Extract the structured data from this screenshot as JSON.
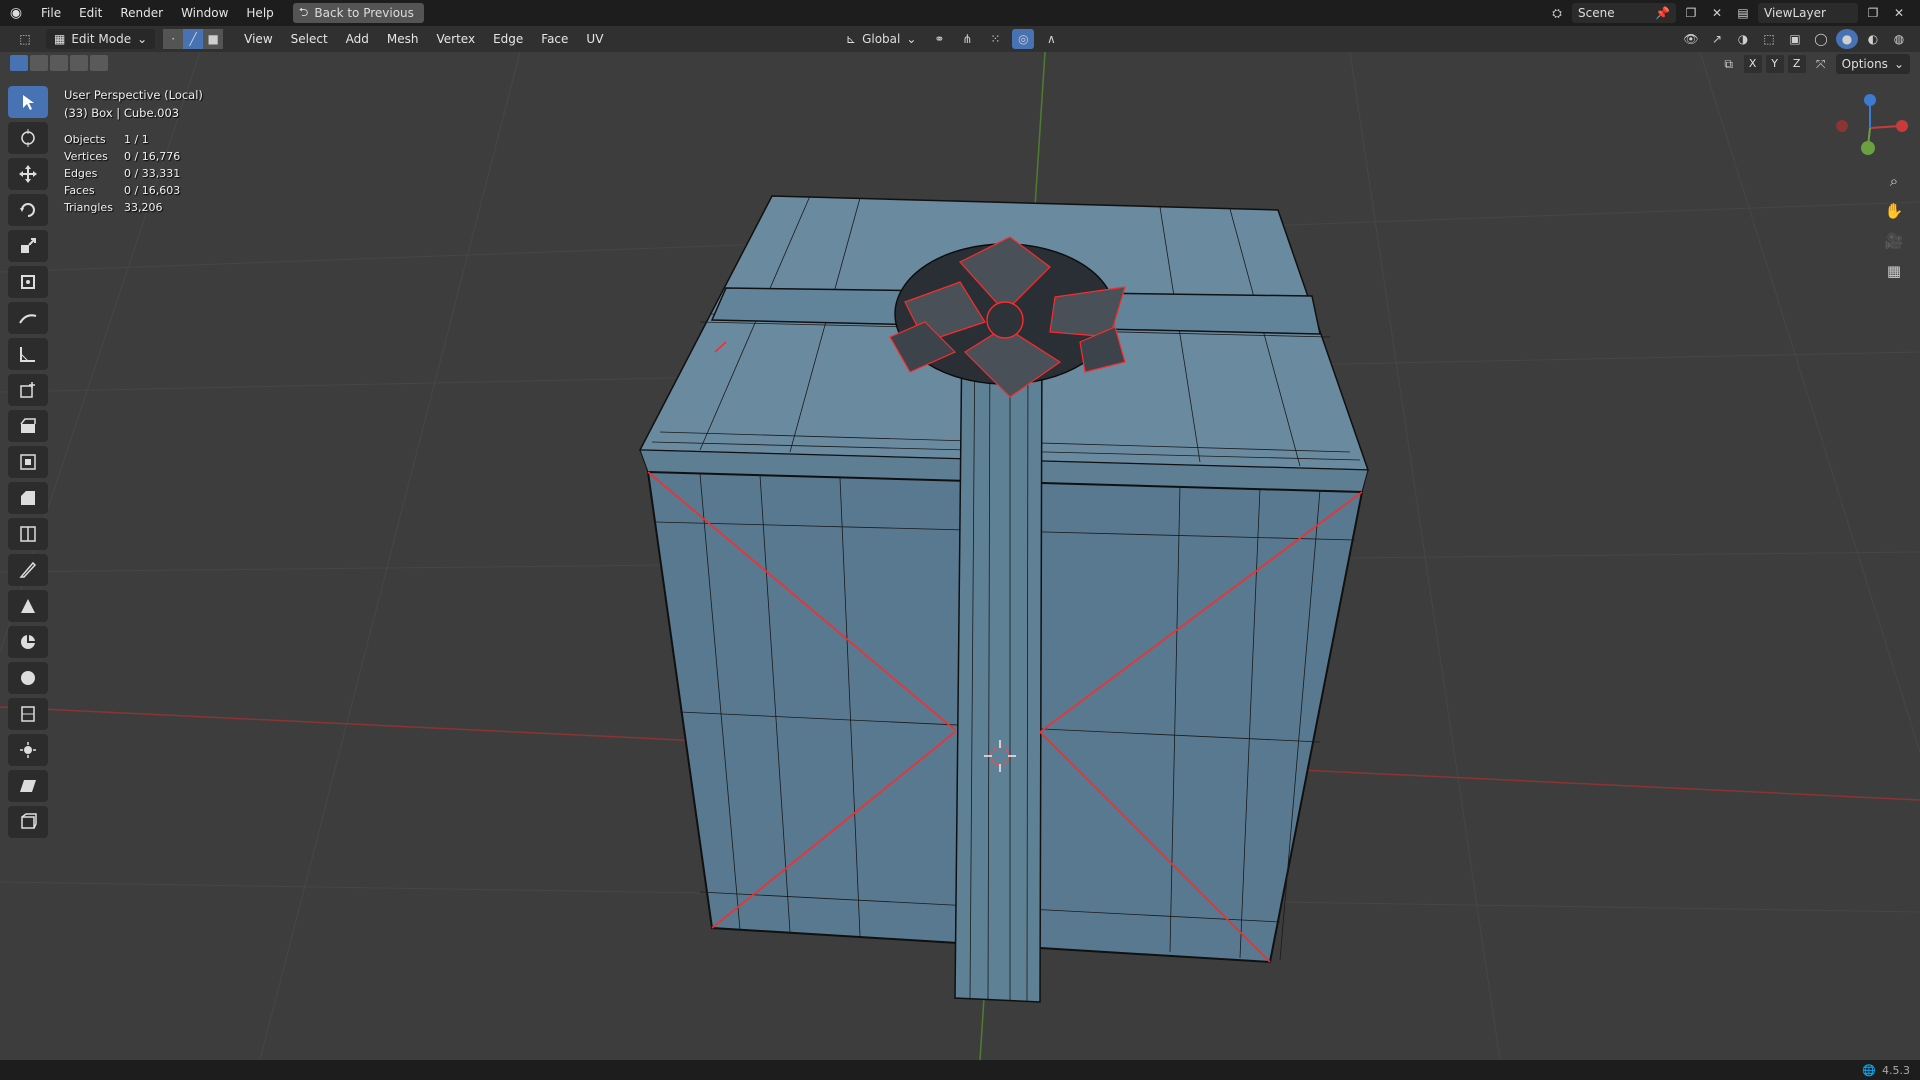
{
  "topbar": {
    "menus": [
      "File",
      "Edit",
      "Render",
      "Window",
      "Help"
    ],
    "back_label": "Back to Previous",
    "scene": "Scene",
    "viewlayer": "ViewLayer"
  },
  "header": {
    "mode": "Edit Mode",
    "menus": [
      "View",
      "Select",
      "Add",
      "Mesh",
      "Vertex",
      "Edge",
      "Face",
      "UV"
    ],
    "orientation": "Global",
    "options_label": "Options",
    "axes": [
      "X",
      "Y",
      "Z"
    ]
  },
  "viewport": {
    "view_name": "User Perspective (Local)",
    "object_info": "(33) Box | Cube.003",
    "stats": [
      {
        "label": "Objects",
        "value": "1 / 1"
      },
      {
        "label": "Vertices",
        "value": "0 / 16,776"
      },
      {
        "label": "Edges",
        "value": "0 / 33,331"
      },
      {
        "label": "Faces",
        "value": "0 / 16,603"
      },
      {
        "label": "Triangles",
        "value": "33,206"
      }
    ]
  },
  "tools": [
    "select-box",
    "cursor",
    "move",
    "rotate",
    "scale",
    "transform",
    "annotate",
    "measure",
    "add-cube",
    "extrude-region",
    "inset-faces",
    "bevel",
    "loop-cut",
    "knife",
    "poly-build",
    "spin",
    "smooth",
    "edge-slide",
    "shrink-fatten",
    "shear",
    "rip-region"
  ],
  "status": {
    "version": "4.5.3"
  },
  "colors": {
    "accent": "#4772b3",
    "box_face": "#5f8196",
    "seam": "#ff2a2a",
    "x_axis": "#c93b3b",
    "y_axis": "#6aa040",
    "z_axis": "#3b7bd1"
  }
}
